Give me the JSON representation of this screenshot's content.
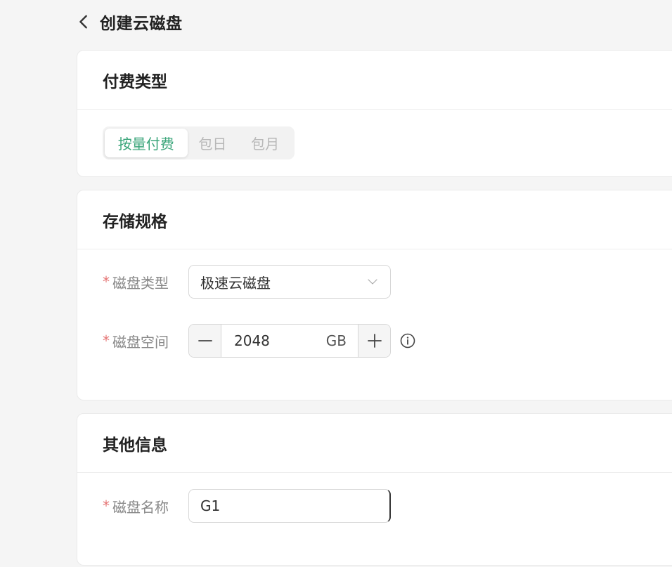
{
  "header": {
    "title": "创建云磁盘"
  },
  "billing": {
    "title": "付费类型",
    "options": [
      {
        "label": "按量付费",
        "active": true
      },
      {
        "label": "包日",
        "active": false
      },
      {
        "label": "包月",
        "active": false
      }
    ]
  },
  "storage": {
    "title": "存储规格",
    "disk_type_label": "磁盘类型",
    "disk_type_value": "极速云磁盘",
    "disk_size_label": "磁盘空间",
    "disk_size_value": "2048",
    "disk_size_unit": "GB"
  },
  "other": {
    "title": "其他信息",
    "disk_name_label": "磁盘名称",
    "disk_name_value": "G1"
  },
  "required_mark": "*",
  "colors": {
    "accent": "#3aa57a",
    "required": "#e57373"
  }
}
